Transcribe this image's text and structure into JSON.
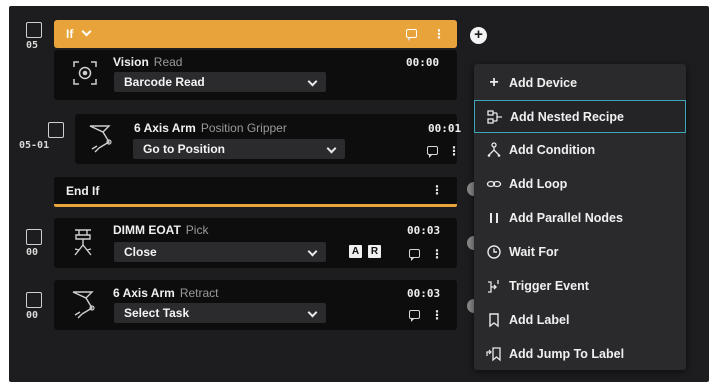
{
  "colors": {
    "accent": "#e8a33a",
    "background": "#1d1d1f",
    "node": "#0d0d0e",
    "highlight": "#3aa6b8"
  },
  "if_block": {
    "label": "If",
    "end_label": "End If",
    "step": "05"
  },
  "steps": [
    {
      "step": "",
      "device": "Vision",
      "action": "Read",
      "task": "Barcode Read",
      "time": "00:00",
      "icon": "camera-icon"
    },
    {
      "step": "05-01",
      "device": "6 Axis Arm",
      "action": "Position Gripper",
      "task": "Go to Position",
      "time": "00:01",
      "icon": "robot-arm-icon"
    },
    {
      "step": "00",
      "device": "DIMM EOAT",
      "action": "Pick",
      "task": "Close",
      "time": "00:03",
      "icon": "gripper-icon",
      "badges": [
        "A",
        "R"
      ]
    },
    {
      "step": "00",
      "device": "6 Axis Arm",
      "action": "Retract",
      "task": "Select Task",
      "time": "00:03",
      "icon": "robot-arm-icon"
    }
  ],
  "menu": {
    "items": [
      {
        "label": "Add Device",
        "icon": "plus-icon"
      },
      {
        "label": "Add Nested Recipe",
        "icon": "nested-recipe-icon"
      },
      {
        "label": "Add Condition",
        "icon": "condition-icon"
      },
      {
        "label": "Add Loop",
        "icon": "loop-icon"
      },
      {
        "label": "Add Parallel Nodes",
        "icon": "parallel-icon"
      },
      {
        "label": "Wait For",
        "icon": "clock-icon"
      },
      {
        "label": "Trigger Event",
        "icon": "trigger-icon"
      },
      {
        "label": "Add Label",
        "icon": "bookmark-icon"
      },
      {
        "label": "Add Jump To Label",
        "icon": "jump-label-icon"
      }
    ],
    "active_index": 1
  }
}
